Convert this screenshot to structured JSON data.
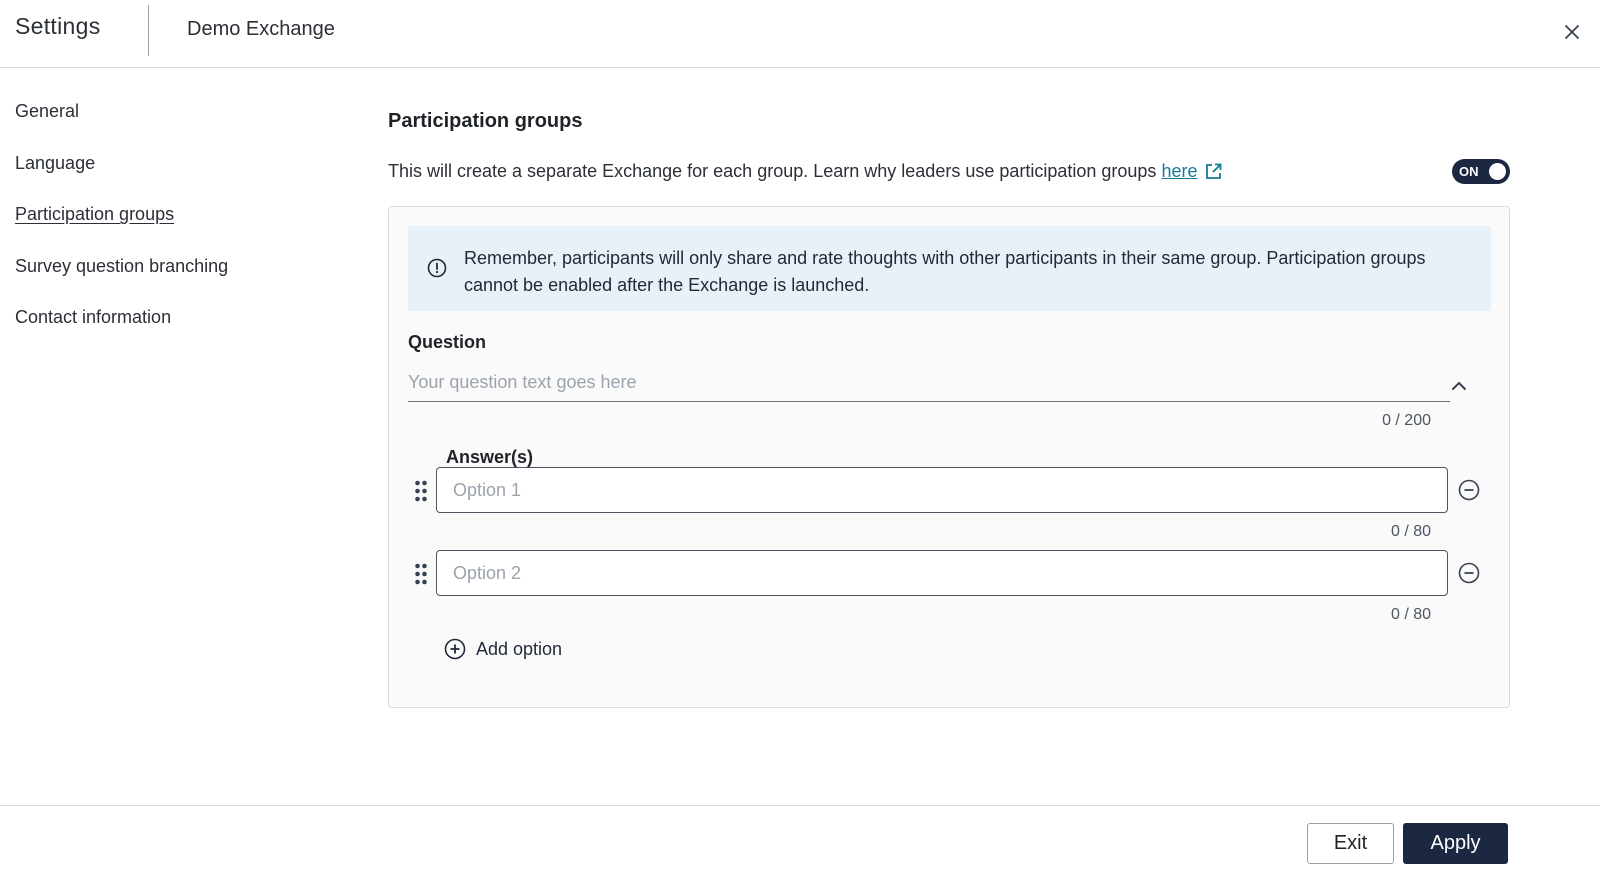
{
  "header": {
    "title": "Settings",
    "subtitle": "Demo Exchange",
    "close_icon": "close-icon"
  },
  "sidebar": {
    "items": [
      {
        "label": "General",
        "active": false
      },
      {
        "label": "Language",
        "active": false
      },
      {
        "label": "Participation groups",
        "active": true
      },
      {
        "label": "Survey question branching",
        "active": false
      },
      {
        "label": "Contact information",
        "active": false
      }
    ]
  },
  "main": {
    "section_title": "Participation groups",
    "description": "This will create a separate Exchange for each group. Learn why leaders use participation groups",
    "link_text": "here",
    "link_icon": "external-link-icon",
    "toggle_label": "ON",
    "toggle_on": true,
    "alert": {
      "icon": "info-icon",
      "text": "Remember, participants will only share and rate thoughts with other participants in their same group. Participation groups cannot be enabled after the Exchange is launched."
    },
    "question": {
      "label": "Question",
      "placeholder": "Your question text goes here",
      "value": "",
      "counter": "0 / 200",
      "collapse_icon": "chevron-up-icon"
    },
    "answers": {
      "label": "Answer(s)",
      "options": [
        {
          "placeholder": "Option 1",
          "value": "",
          "counter": "0 / 80"
        },
        {
          "placeholder": "Option 2",
          "value": "",
          "counter": "0 / 80"
        }
      ],
      "add_label": "Add option"
    }
  },
  "footer": {
    "exit_label": "Exit",
    "apply_label": "Apply"
  },
  "colors": {
    "primary": "#1c2741",
    "link": "#137a9a",
    "alert_bg": "#e8f0f8"
  }
}
